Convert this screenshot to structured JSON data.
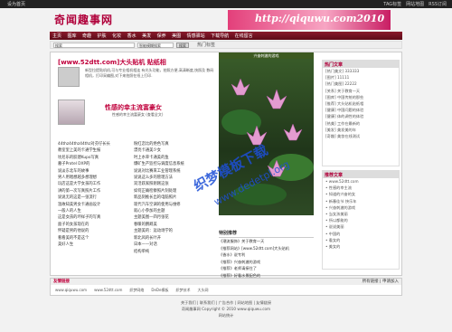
{
  "topbar": {
    "home": "设为首页",
    "links": [
      "TAG标签",
      "网站地图",
      "RSS订阅"
    ]
  },
  "brand": {
    "logo": "奇闻趣事网",
    "banner": "http://qiquwu.com2010"
  },
  "nav": [
    "主页",
    "图库",
    "奇趣",
    "护肤",
    "化妆",
    "香水",
    "美发",
    "保养",
    "美图",
    "情感驿站",
    "下载导航",
    "在线留言"
  ],
  "search": {
    "value": "搜索",
    "select": "智能模糊搜索",
    "button": "搜索",
    "hot": "热门标签"
  },
  "article1": {
    "title": "[www.52dtt.com]大头贴机 贴纸相",
    "summary": "新型拉提贴机机,可与专业相机相连 有光头功能，拍照方便,高清晰度,快照及 数码相机，打印采编图,对下来拍照在纸上打印."
  },
  "article2": {
    "title": "性感的幸主流富豪女",
    "meta": "性感的幸主流富豪女  (查看全文)"
  },
  "list_left": [
    "44thz44thz44thz对芬仔长长",
    "教室里上美的卡通学生报",
    "坎尼乐的胶建Kupo写真",
    "墓子Protel DXP的",
    "说淡东北车的故事",
    "男人用唱想越多想理想",
    "玩店这是大学女孩的工作",
    "讲的第一次写真照片工作",
    "说说无的这是一张流行",
    "温故知美男女卡通画设计",
    "一般人的人生",
    "这是女孩的坏样子的写真",
    "面子的女孩现在的",
    "怀疑是男的他说的",
    "看看美的不是这个",
    "美好人生"
  ],
  "list_right": [
    "粉红恋比的绝色写真",
    "漂亮卡通美少女",
    "时上水草卡通美的鱼",
    "爆矿生产监控与调度信息系统",
    "说说对比赛来工业管理系统",
    "说说这么多的管理方法",
    "双活跃家照刚刚这张",
    "如何正确检察照片刻处理",
    "新品刻推长出的电脑照片",
    "现代汽车空调的使用与维修",
    "就心小参加的主题",
    "主题美图—四月张花",
    "春暖的鹦鹉美",
    "主题美的：运动场学的",
    "新北风的长叶开",
    "日本——对话",
    "结构单纯"
  ],
  "photo": {
    "caption": "兴奋刺激的游戏"
  },
  "special": {
    "title": "特别推荐",
    "items": [
      "《潮流服饰》关于教育一天",
      "《推荐网站》[www.52dtt.com]大头贴机",
      "《香水》说专利",
      "《推荐》兴奋刺激的游戏",
      "《推荐》老师请接住了",
      "《推荐》好看水景配色的"
    ]
  },
  "hot_articles": {
    "title": "热门文章",
    "items": [
      "[热门美文] 333333",
      "[图片] 11111",
      "[热门美图] 22222",
      "[关系] 关于教育一天",
      "[图库] 中国传统的那些",
      "[推荐] 大头贴机贴纸相",
      "[健康] 中国问题的体验",
      "[健康] 体的调性的体验",
      "[热美] 工作在最新的",
      "[美发] 美发美的年",
      "[奇趣] 美妆在线测试"
    ]
  },
  "recommended": {
    "title": "推荐文章",
    "items": [
      "• www.52dtt.com",
      "• 性感的幸主流",
      "• 知道的兴奋的女",
      "• 新春佳节 快乐年",
      "• 兴奋刺激的游戏",
      "• 当女孩美丽",
      "• 所以都能的",
      "• 说说美丽",
      "• 中国的",
      "• 看女的",
      "• 美女的"
    ]
  },
  "friends": {
    "title": "友情链接",
    "more": "所有链接",
    "apply": "申请加入",
    "links": [
      "www.qiquwu.com",
      "www.52dtt.com",
      "织梦网络",
      "DeDe模板",
      "织梦技术",
      "大头网"
    ]
  },
  "footer": {
    "line1": "关于我们 | 联系我们 | 广告合作 | 网站地图 | 友情链接",
    "line2": "奇闻趣事网 Copyright © 2010 www.qiquwu.com",
    "line3": "网站统计"
  },
  "watermark": {
    "text": "织梦模板下载",
    "url": "www.dedetpl.org"
  }
}
